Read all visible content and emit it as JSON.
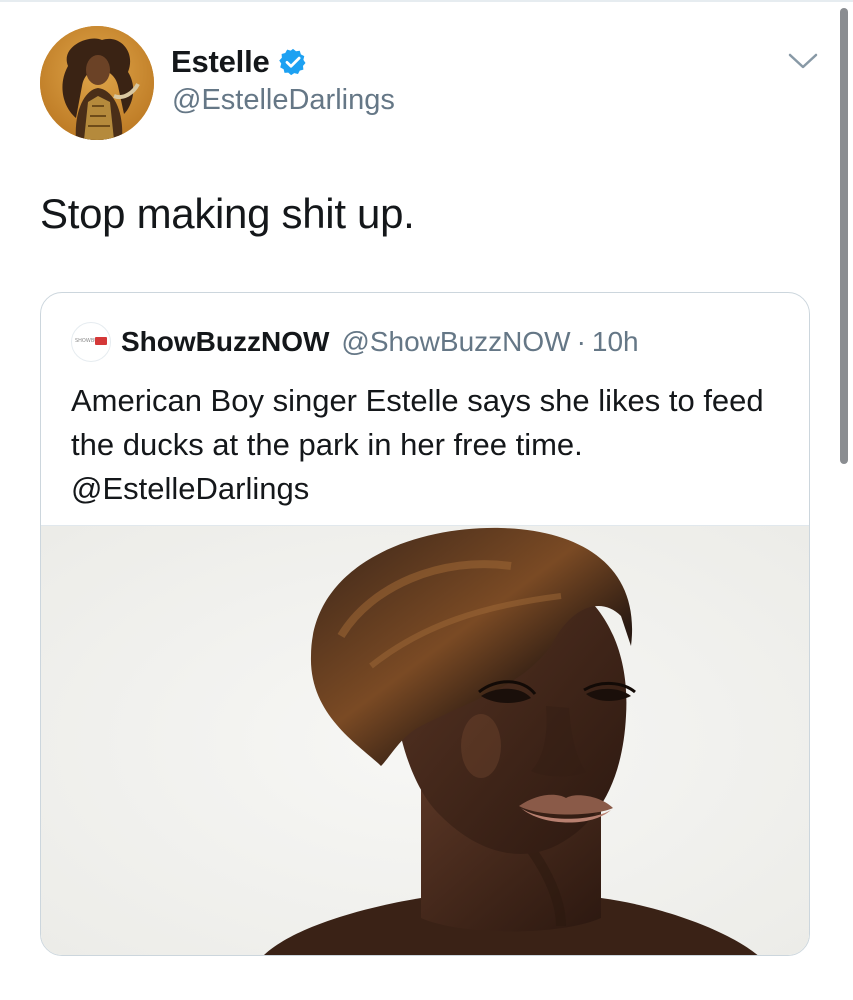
{
  "tweet": {
    "author": {
      "display_name": "Estelle",
      "handle": "@EstelleDarlings",
      "verified_icon": "verified-badge-icon",
      "avatar_icon": "profile-photo"
    },
    "text": "Stop making shit up.",
    "menu_icon": "chevron-down-icon"
  },
  "quoted_tweet": {
    "author": {
      "display_name": "ShowBuzzNOW",
      "handle": "@ShowBuzzNOW",
      "separator": "·",
      "time": "10h",
      "avatar_icon": "showbuzz-logo"
    },
    "text": "American Boy singer Estelle says she likes to feed the ducks at the park in her free time. @EstelleDarlings",
    "media": "portrait-photo"
  },
  "colors": {
    "primary_text": "#14171a",
    "secondary_text": "#657786",
    "verified_blue": "#1da1f2",
    "border": "#ccd6dd"
  }
}
